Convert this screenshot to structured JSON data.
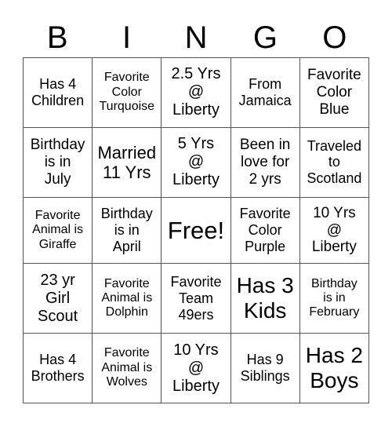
{
  "header": [
    "B",
    "I",
    "N",
    "G",
    "O"
  ],
  "rows": [
    [
      "Has 4\nChildren",
      "Favorite\nColor\nTurquoise",
      "2.5 Yrs\n@\nLiberty",
      "From\nJamaica",
      "Favorite\nColor\nBlue"
    ],
    [
      "Birthday\nis in\nJuly",
      "Married\n11 Yrs",
      "5 Yrs\n@\nLiberty",
      "Been in\nlove for\n2 yrs",
      "Traveled\nto\nScotland"
    ],
    [
      "Favorite\nAnimal is\nGiraffe",
      "Birthday\nis in\nApril",
      "Free!",
      "Favorite\nColor\nPurple",
      "10 Yrs\n@\nLiberty"
    ],
    [
      "23 yr\nGirl\nScout",
      "Favorite\nAnimal is\nDolphin",
      "Favorite\nTeam\n49ers",
      "Has 3\nKids",
      "Birthday\nis in\nFebruary"
    ],
    [
      "Has 4\nBrothers",
      "Favorite\nAnimal is\nWolves",
      "10 Yrs\n@\nLiberty",
      "Has 9\nSiblings",
      "Has 2\nBoys"
    ]
  ]
}
